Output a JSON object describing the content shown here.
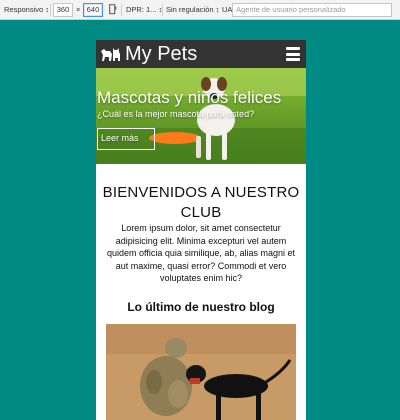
{
  "devtools": {
    "device": "Responsivo",
    "width": "360",
    "times": "×",
    "height": "640",
    "dpr": "DPR: 1...",
    "throttle": "Sin regulación",
    "ua_label": "UA:",
    "ua_placeholder": "Agente de usuario personalizado"
  },
  "site": {
    "brand": "My Pets",
    "hero": {
      "title": "Mascotas y niños felices",
      "subtitle": "¿Cuál es la mejor mascota para usted?",
      "button": "Leer más"
    },
    "welcome": "BIENVENIDOS A NUESTRO CLUB",
    "lorem": "Lorem ipsum dolor, sit amet consectetur adipisicing elit. Minima excepturi vel autem quidem officia quia similique, ab, alias magni et aut maxime, quasi error? Commodi et vero voluptates enim hic?",
    "blog_title": "Lo último de nuestro blog"
  },
  "colors": {
    "page_background": "#008a84",
    "navbar": "#333333",
    "text": "#111111"
  },
  "icons": [
    "paw-logo-icon",
    "hamburger-menu-icon",
    "rotate-icon"
  ]
}
